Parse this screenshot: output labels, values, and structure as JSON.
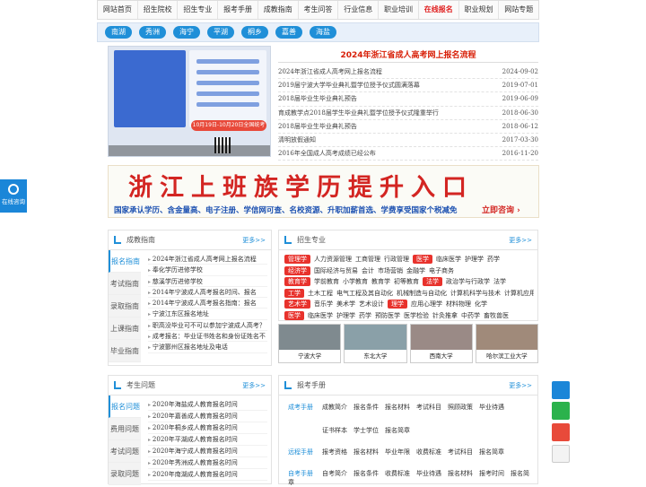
{
  "nav": {
    "items": [
      "网站首页",
      "招生院校",
      "招生专业",
      "报考手册",
      "成教指南",
      "考生问答",
      "行业信息",
      "职业培训",
      "在线报名",
      "职业规划",
      "网站专题"
    ],
    "active_index": 8
  },
  "cities": [
    "南湖",
    "秀洲",
    "海宁",
    "平湖",
    "桐乡",
    "嘉善",
    "海盐"
  ],
  "slide": {
    "banner": "10月19日-10月20日全国统考"
  },
  "news": {
    "title": "2024年浙江省成人高考网上报名流程",
    "items": [
      {
        "t": "2024年浙江省成人高考网上报名流程",
        "d": "2024-09-02"
      },
      {
        "t": "2019届宁波大学毕业典礼暨学位授予仪式圆满落幕",
        "d": "2019-07-01"
      },
      {
        "t": "2018届毕业生毕业典礼预告",
        "d": "2019-06-09"
      },
      {
        "t": "育成教学点2018届学生毕业典礼暨学位授予仪式隆重举行",
        "d": "2018-06-30"
      },
      {
        "t": "2018届毕业生毕业典礼预告",
        "d": "2018-06-12"
      },
      {
        "t": "清明放假通知",
        "d": "2017-03-30"
      },
      {
        "t": "2016年全国成人高考成绩已经公布",
        "d": "2016-11-20"
      }
    ]
  },
  "ad": {
    "headline": "浙江上班族学历提升入口",
    "sub": "国家承认学历、含金量高、电子注册、学信网可查、名校资源、升职加薪首选、学费享受国家个税减免",
    "cta": "立即咨询 ›"
  },
  "float_left": {
    "label": "在线咨询"
  },
  "guide_panel": {
    "title": "成教指南",
    "more": "更多>>",
    "tabs": [
      "报名指南",
      "考试指南",
      "录取指南",
      "上课指南",
      "毕业指南"
    ],
    "items": [
      "2024年浙江省成人高考网上报名流程",
      "奉化学历进修学校",
      "慈溪学历进修学校",
      "2014年宁波成人高考报名时间、报名",
      "2014年宁波成人高考报名指南：报名",
      "宁波江东区报名地址",
      "职高没毕业可不可以参加宁波成人高考？",
      "成考报名：毕业证书姓名和身份证姓名不",
      "宁波鄞州区报名地址及电话"
    ]
  },
  "major_panel": {
    "title": "招生专业",
    "more": "更多>>",
    "rows": [
      {
        "tag": "管理学",
        "items": [
          "人力资源管理",
          "工商管理",
          "行政管理"
        ],
        "tag2": "医学",
        "items2": [
          "临床医学",
          "护理学",
          "药学"
        ]
      },
      {
        "tag": "经济学",
        "items": [
          "国际经济与贸易",
          "会计",
          "市场营销",
          "金融学",
          "电子商务"
        ]
      },
      {
        "tag": "教育学",
        "items": [
          "学前教育",
          "小学教育",
          "教育学",
          "初等教育"
        ],
        "tag2": "法学",
        "items2": [
          "政治学与行政学",
          "法学"
        ]
      },
      {
        "tag": "工学",
        "items": [
          "土木工程",
          "电气工程及其自动化",
          "机械制造与自动化",
          "计算机科学与技术",
          "计算机应用技术"
        ]
      },
      {
        "tag": "艺术学",
        "items": [
          "音乐学",
          "美术学",
          "艺术设计"
        ],
        "tag2": "理学",
        "items2": [
          "应用心理学",
          "材料物理",
          "化学"
        ]
      },
      {
        "tag": "医学",
        "items": [
          "临床医学",
          "护理学",
          "药学",
          "预防医学",
          "医学检验",
          "针灸推拿",
          "中药学",
          "畜牧兽医"
        ]
      }
    ]
  },
  "logos": [
    "宁波大学",
    "东北大学",
    "西南大学",
    "哈尔滨工业大学"
  ],
  "qa_panel": {
    "title": "考生问题",
    "more": "更多>>",
    "tabs": [
      "报名问题",
      "费用问题",
      "考试问题",
      "录取问题"
    ],
    "items": [
      "2020年海盐成人教育报名时间",
      "2020年嘉善成人教育报名时间",
      "2020年桐乡成人教育报名时间",
      "2020年平湖成人教育报名时间",
      "2020年海宁成人教育报名时间",
      "2020年秀洲成人教育报名时间",
      "2020年南湖成人教育报名时间"
    ]
  },
  "handbook_panel": {
    "title": "报考手册",
    "more": "更多>>",
    "groups": [
      {
        "label": "成考手册",
        "items": [
          "成教简介",
          "报名条件",
          "报名材料",
          "考试科目",
          "照顾政策",
          "毕业待遇"
        ]
      },
      {
        "label": "",
        "items": [
          "证书样本",
          "学士学位",
          "报名简章"
        ]
      },
      {
        "label": "远程手册",
        "items": [
          "报考资格",
          "报名材料",
          "毕业年限",
          "收费标准",
          "考试科目",
          "报名简章"
        ]
      },
      {
        "label": "自考手册",
        "items": [
          "自考简介",
          "报名条件",
          "收费标准",
          "毕业待遇",
          "报名材料",
          "报考时间",
          "报名简章"
        ]
      }
    ]
  }
}
